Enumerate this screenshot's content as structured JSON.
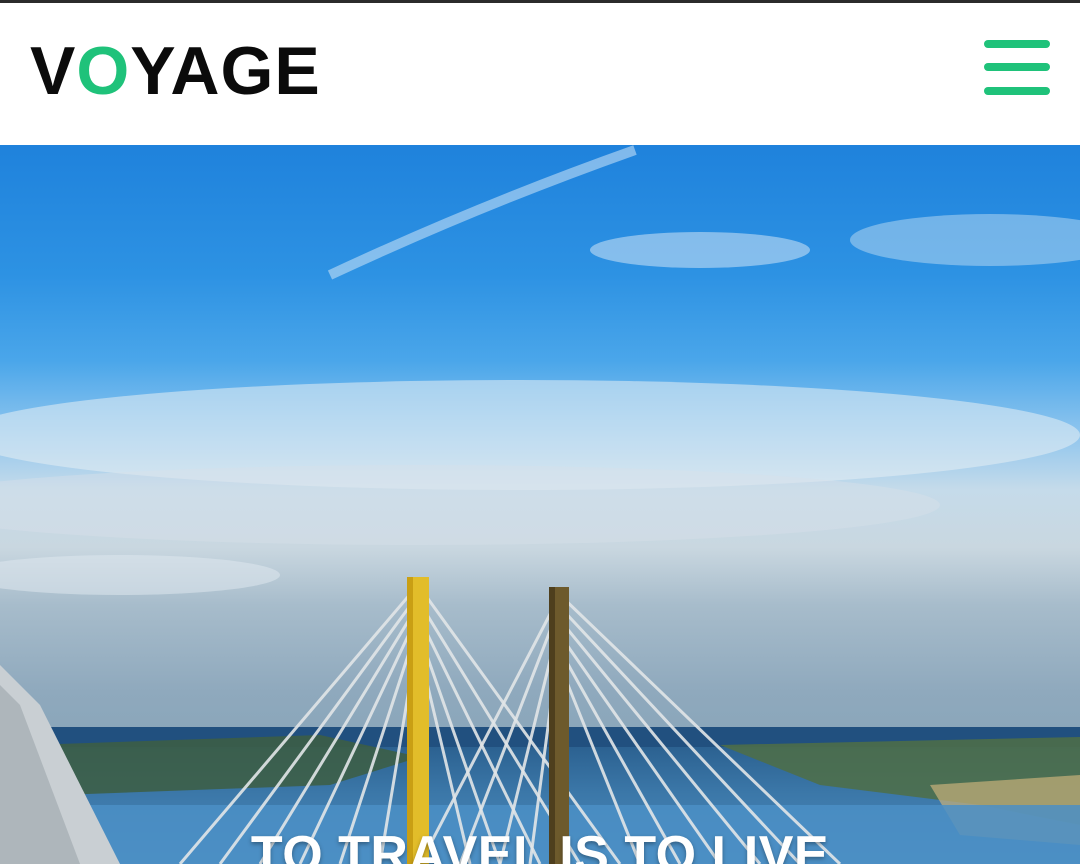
{
  "header": {
    "logo": {
      "prefix": "V",
      "accent": "O",
      "suffix": "YAGE"
    }
  },
  "hero": {
    "title": "TO TRAVEL IS TO LIVE",
    "image": "cable-stayed-bridge-over-water"
  },
  "icons": {
    "menu": "hamburger-menu-icon"
  },
  "colors": {
    "accent": "#1fc27a",
    "logo_text": "#0b0b0b",
    "header_bg": "#ffffff",
    "hero_title": "#ffffff"
  }
}
